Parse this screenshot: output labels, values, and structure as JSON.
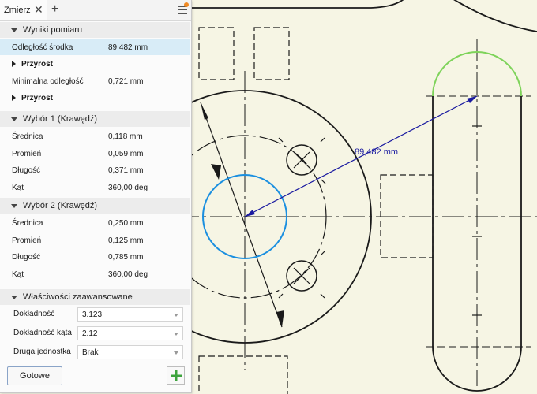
{
  "panel": {
    "tab_title": "Zmierz",
    "close_glyph": "✕",
    "add_glyph": "+",
    "sections": {
      "results": {
        "title": "Wyniki pomiaru",
        "center_distance_label": "Odległość środka",
        "center_distance_value": "89,482 mm",
        "increment_label_1": "Przyrost",
        "min_distance_label": "Minimalna odległość",
        "min_distance_value": "0,721 mm",
        "increment_label_2": "Przyrost"
      },
      "selection1": {
        "title": "Wybór 1 (Krawędź)",
        "rows": [
          {
            "label": "Średnica",
            "value": "0,118 mm"
          },
          {
            "label": "Promień",
            "value": "0,059 mm"
          },
          {
            "label": "Długość",
            "value": "0,371 mm"
          },
          {
            "label": "Kąt",
            "value": "360,00 deg"
          }
        ]
      },
      "selection2": {
        "title": "Wybór 2 (Krawędź)",
        "rows": [
          {
            "label": "Średnica",
            "value": "0,250 mm"
          },
          {
            "label": "Promień",
            "value": "0,125 mm"
          },
          {
            "label": "Długość",
            "value": "0,785 mm"
          },
          {
            "label": "Kąt",
            "value": "360,00 deg"
          }
        ]
      },
      "advanced": {
        "title": "Właściwości zaawansowane",
        "fields": [
          {
            "label": "Dokładność",
            "value": "3.123"
          },
          {
            "label": "Dokładność kąta",
            "value": "2.12"
          },
          {
            "label": "Druga jednostka",
            "value": "Brak"
          }
        ]
      }
    },
    "done_button": "Gotowe",
    "add_button_glyph": "+"
  },
  "drawing": {
    "dimension_text": "89,482 mm",
    "colors": {
      "background": "#f6f5e4",
      "lines": "#1a1a1a",
      "selection_circle": "#1a8fe0",
      "selection_arc": "#7ed35a",
      "dimension": "#1a1aa0"
    }
  }
}
